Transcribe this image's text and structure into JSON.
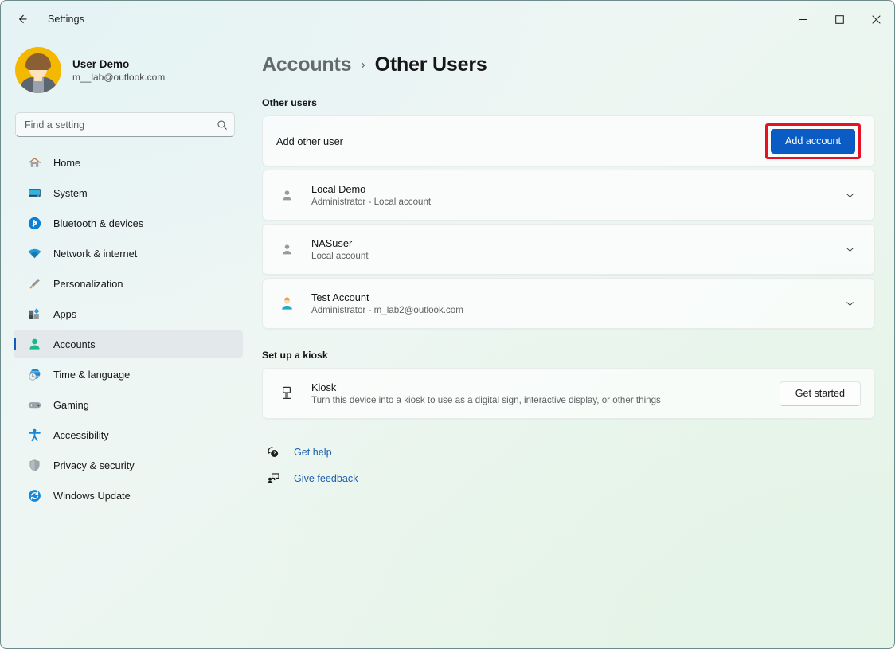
{
  "window": {
    "app_title": "Settings",
    "back_icon": "arrow-left-icon",
    "controls": {
      "minimize": "minimize-icon",
      "maximize": "maximize-icon",
      "close": "close-icon"
    }
  },
  "sidebar": {
    "profile": {
      "name": "User Demo",
      "email": "m__lab@outlook.com",
      "avatar_icon": "user-avatar"
    },
    "search": {
      "placeholder": "Find a setting",
      "value": "",
      "icon": "search-icon"
    },
    "items": [
      {
        "label": "Home",
        "icon": "home-icon",
        "selected": false
      },
      {
        "label": "System",
        "icon": "system-icon",
        "selected": false
      },
      {
        "label": "Bluetooth & devices",
        "icon": "bluetooth-icon",
        "selected": false
      },
      {
        "label": "Network & internet",
        "icon": "wifi-icon",
        "selected": false
      },
      {
        "label": "Personalization",
        "icon": "paintbrush-icon",
        "selected": false
      },
      {
        "label": "Apps",
        "icon": "apps-icon",
        "selected": false
      },
      {
        "label": "Accounts",
        "icon": "accounts-icon",
        "selected": true
      },
      {
        "label": "Time & language",
        "icon": "clock-globe-icon",
        "selected": false
      },
      {
        "label": "Gaming",
        "icon": "gamepad-icon",
        "selected": false
      },
      {
        "label": "Accessibility",
        "icon": "accessibility-icon",
        "selected": false
      },
      {
        "label": "Privacy & security",
        "icon": "shield-icon",
        "selected": false
      },
      {
        "label": "Windows Update",
        "icon": "update-icon",
        "selected": false
      }
    ]
  },
  "main": {
    "breadcrumb": {
      "parent": "Accounts",
      "separator": "›",
      "current": "Other Users"
    },
    "other_users": {
      "section_label": "Other users",
      "add_row": {
        "label": "Add other user",
        "button_label": "Add account",
        "button_highlighted": true,
        "highlight_color": "#e81123",
        "accent_color": "#0a5cc4"
      },
      "accounts": [
        {
          "name": "Local Demo",
          "detail": "Administrator - Local account",
          "avatar_icon": "person-generic-icon",
          "expand_icon": "chevron-down-icon"
        },
        {
          "name": "NASuser",
          "detail": "Local account",
          "avatar_icon": "person-generic-icon",
          "expand_icon": "chevron-down-icon"
        },
        {
          "name": "Test Account",
          "detail": "Administrator - m_lab2@outlook.com",
          "avatar_icon": "person-color-icon",
          "expand_icon": "chevron-down-icon"
        }
      ]
    },
    "kiosk": {
      "section_label": "Set up a kiosk",
      "title": "Kiosk",
      "detail": "Turn this device into a kiosk to use as a digital sign, interactive display, or other things",
      "icon": "kiosk-icon",
      "button_label": "Get started"
    },
    "links": [
      {
        "label": "Get help",
        "icon": "help-icon"
      },
      {
        "label": "Give feedback",
        "icon": "feedback-icon"
      }
    ]
  }
}
